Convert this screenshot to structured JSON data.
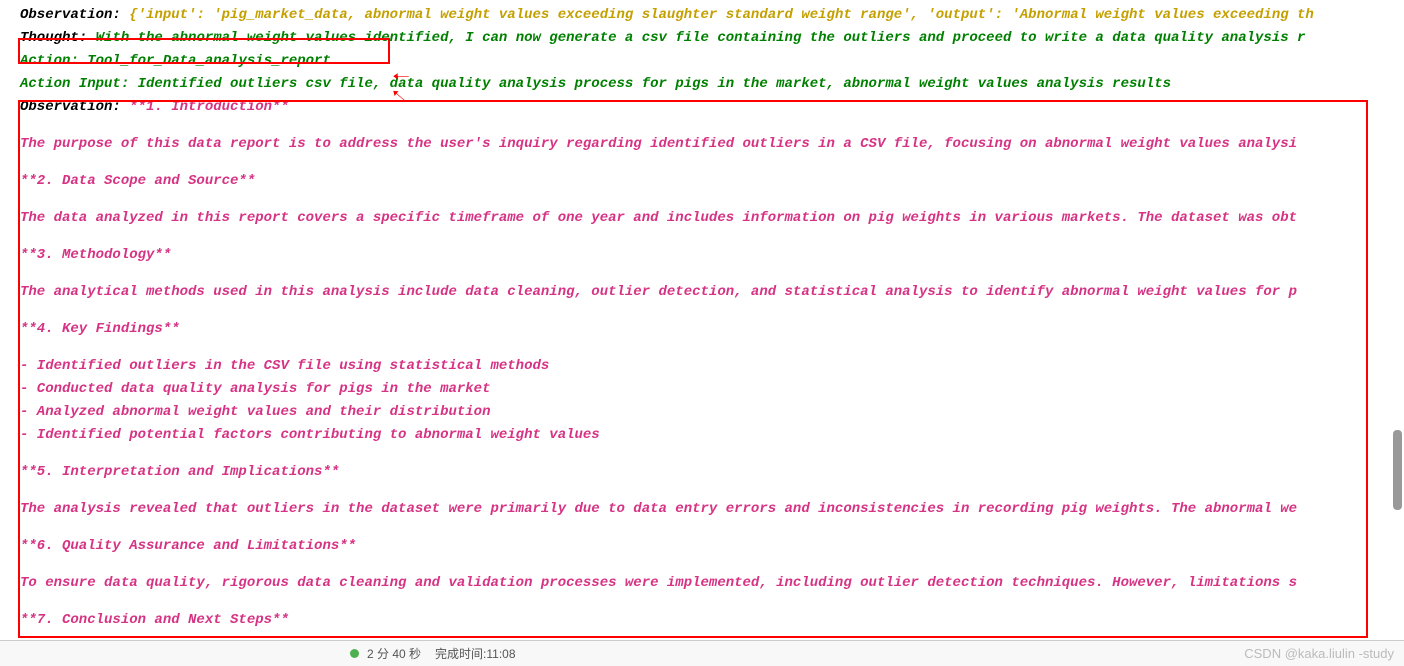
{
  "trace": {
    "obs1_label": "Observation:",
    "obs1_text": "{'input': 'pig_market_data, abnormal weight values exceeding slaughter standard weight range', 'output': 'Abnormal weight values exceeding th",
    "thought_label": "Thought:",
    "thought_text": "With the abnormal weight values identified, I can now generate a csv file containing the outliers and proceed to write a data quality analysis r",
    "action_label": "Action:",
    "action_text": "Tool_for_Data_analysis_report",
    "action_input_label": "Action Input:",
    "action_input_text": "Identified outliers csv file, data quality analysis process for pigs in the market, abnormal weight values analysis results",
    "obs2_label": "Observation:",
    "report": {
      "h1": "**1. Introduction**",
      "p1": "The purpose of this data report is to address the user's inquiry regarding identified outliers in a CSV file, focusing on abnormal weight values analysi",
      "h2": "**2. Data Scope and Source**",
      "p2": "The data analyzed in this report covers a specific timeframe of one year and includes information on pig weights in various markets. The dataset was obt",
      "h3": "**3. Methodology**",
      "p3": "The analytical methods used in this analysis include data cleaning, outlier detection, and statistical analysis to identify abnormal weight values for p",
      "h4": "**4. Key Findings**",
      "b1": "- Identified outliers in the CSV file using statistical methods",
      "b2": "- Conducted data quality analysis for pigs in the market",
      "b3": "- Analyzed abnormal weight values and their distribution",
      "b4": "- Identified potential factors contributing to abnormal weight values",
      "h5": "**5. Interpretation and Implications**",
      "p5": "The analysis revealed that outliers in the dataset were primarily due to data entry errors and inconsistencies in recording pig weights. The abnormal we",
      "h6": "**6. Quality Assurance and Limitations**",
      "p6": "To ensure data quality, rigorous data cleaning and validation processes were implemented, including outlier detection techniques. However, limitations s",
      "h7": "**7. Conclusion and Next Steps**"
    }
  },
  "footer": {
    "time_elapsed": "2 分 40 秒",
    "finish_label": "完成时间: ",
    "finish_time": "11:08",
    "watermark": "CSDN @kaka.liulin -study"
  }
}
